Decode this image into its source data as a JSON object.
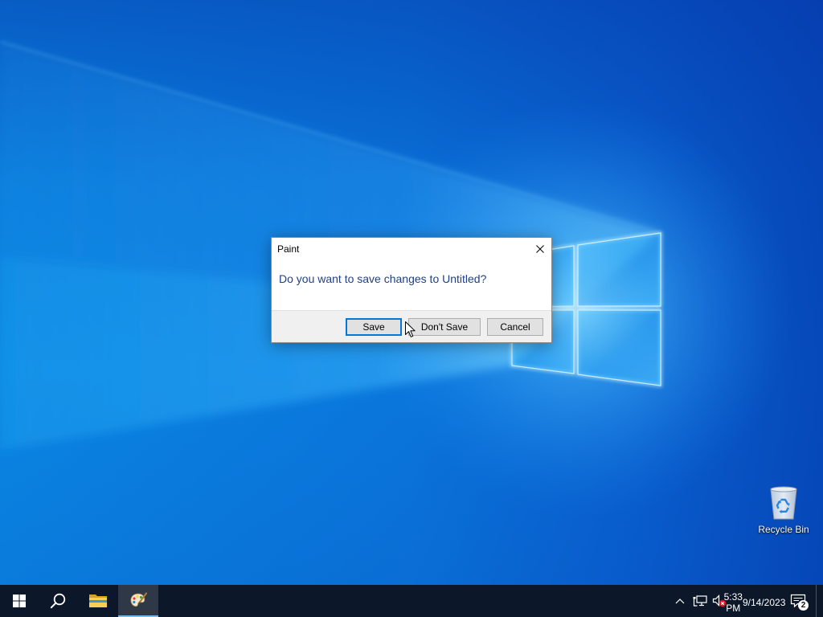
{
  "colors": {
    "accent": "#0078d7",
    "taskbar": "#0c1829",
    "message_text": "#1e3f8a",
    "dialog_panel": "#f0f0f0",
    "active_indicator": "#76b9ed",
    "mute_badge": "#e81123"
  },
  "desktop": {
    "icons": [
      {
        "label": "Recycle Bin",
        "icon": "recycle-bin-icon"
      }
    ]
  },
  "dialog": {
    "title": "Paint",
    "close_icon": "close-icon",
    "message": "Do you want to save changes to Untitled?",
    "buttons": [
      {
        "label": "Save",
        "default": true
      },
      {
        "label": "Don't Save",
        "default": false
      },
      {
        "label": "Cancel",
        "default": false
      }
    ]
  },
  "cursor": {
    "icon": "arrow-pointer-icon"
  },
  "taskbar": {
    "start": {
      "icon": "windows-start-icon"
    },
    "search": {
      "icon": "search-icon"
    },
    "apps": [
      {
        "icon": "file-explorer-icon",
        "active": false
      },
      {
        "icon": "paint-icon",
        "active": true
      }
    ],
    "tray": {
      "icons": [
        "chevron-up-icon",
        "network-icon",
        "volume-muted-icon"
      ],
      "time": "5:33 PM",
      "date": "9/14/2023",
      "notifications_icon": "action-center-icon",
      "notification_count": "2"
    }
  }
}
